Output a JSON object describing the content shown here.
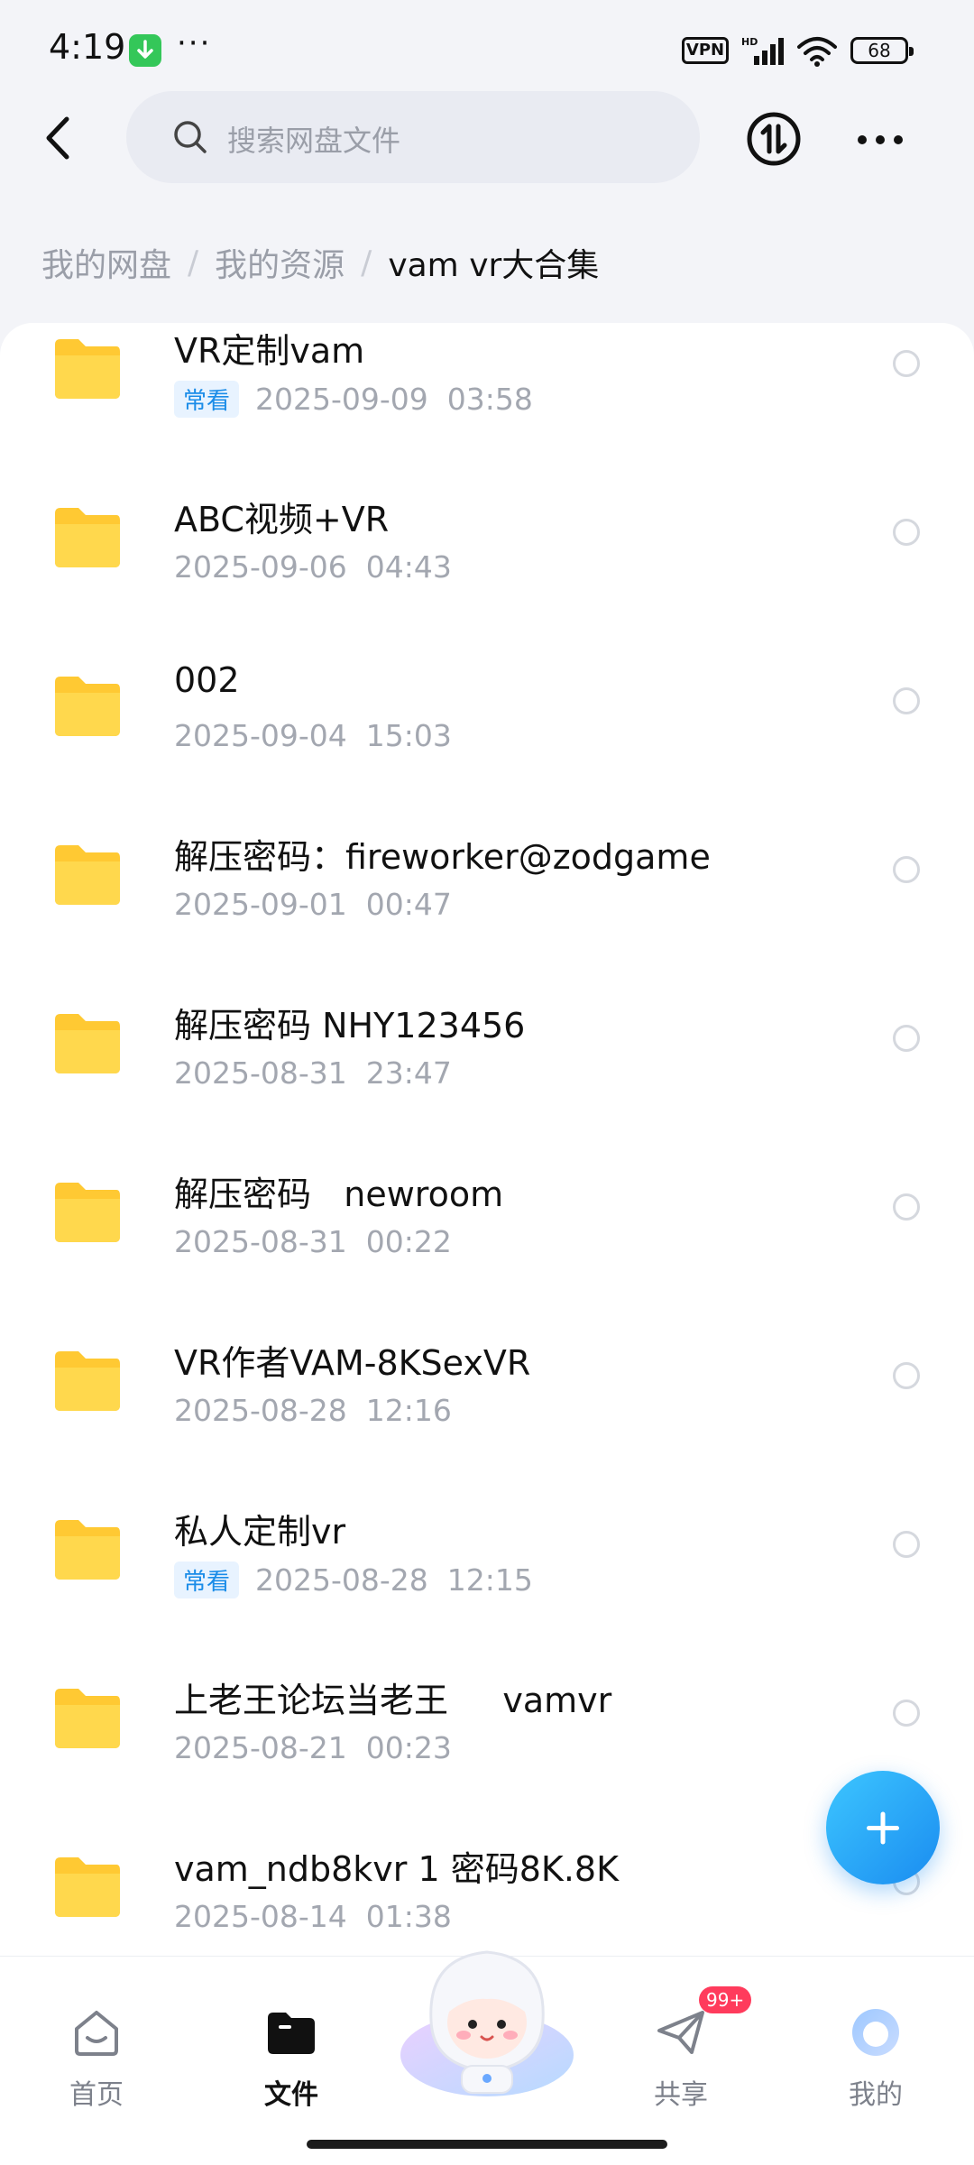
{
  "status_bar": {
    "time": "4:19",
    "dots": "···",
    "vpn": "VPN",
    "battery": "68"
  },
  "header": {
    "search_placeholder": "搜索网盘文件"
  },
  "breadcrumb": {
    "items": [
      "我的网盘",
      "我的资源"
    ],
    "separator": "/",
    "current": "vam vr大合集"
  },
  "files": [
    {
      "name": "VR定制vam",
      "tag": "常看",
      "date": "2025-09-09  03:58"
    },
    {
      "name": "ABC视频+VR",
      "tag": "",
      "date": "2025-09-06  04:43"
    },
    {
      "name": "002",
      "tag": "",
      "date": "2025-09-04  15:03"
    },
    {
      "name": "解压密码：fireworker@zodgame",
      "tag": "",
      "date": "2025-09-01  00:47"
    },
    {
      "name": "解压密码 NHY123456",
      "tag": "",
      "date": "2025-08-31  23:47"
    },
    {
      "name": "解压密码   newroom",
      "tag": "",
      "date": "2025-08-31  00:22"
    },
    {
      "name": "VR作者VAM-8KSexVR",
      "tag": "",
      "date": "2025-08-28  12:16"
    },
    {
      "name": "私人定制vr",
      "tag": "常看",
      "date": "2025-08-28  12:15"
    },
    {
      "name": "上老王论坛当老王     vamvr",
      "tag": "",
      "date": "2025-08-21  00:23"
    },
    {
      "name": "vam_ndb8kvr 1 密码8K.8K",
      "tag": "",
      "date": "2025-08-14  01:38"
    }
  ],
  "bottom_nav": {
    "home": "首页",
    "files": "文件",
    "share": "共享",
    "share_badge": "99+",
    "mine": "我的"
  },
  "colors": {
    "accent": "#1a8cf0",
    "folder": "#ffc933",
    "badge": "#ff3b5c"
  }
}
